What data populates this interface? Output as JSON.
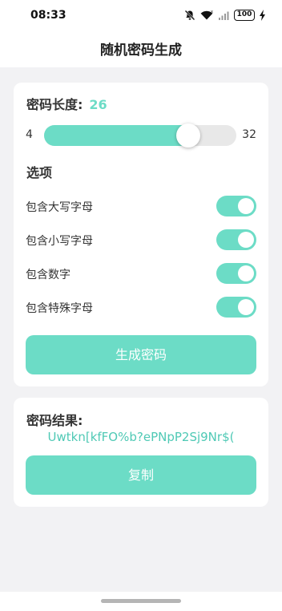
{
  "status_bar": {
    "time": "08:33",
    "battery": "100",
    "icons": [
      "mute-bell-icon",
      "wifi-icon",
      "signal-icon",
      "battery-icon",
      "charging-icon"
    ]
  },
  "app_bar": {
    "title": "随机密码生成"
  },
  "generator": {
    "length_label": "密码长度:",
    "length_value": "26",
    "slider": {
      "min": 4,
      "max": 32,
      "value": 26,
      "min_label": "4",
      "max_label": "32"
    },
    "options_title": "选项",
    "options": [
      {
        "label": "包含大写字母",
        "enabled": true
      },
      {
        "label": "包含小写字母",
        "enabled": true
      },
      {
        "label": "包含数字",
        "enabled": true
      },
      {
        "label": "包含特殊字母",
        "enabled": true
      }
    ],
    "generate_label": "生成密码"
  },
  "result": {
    "label": "密码结果:",
    "value": "Uwtkn[kfFO%b?ePNpP2Sj9Nr$(",
    "copy_label": "复制"
  },
  "colors": {
    "accent": "#6cdcc6",
    "background": "#f2f2f4",
    "card": "#ffffff"
  }
}
